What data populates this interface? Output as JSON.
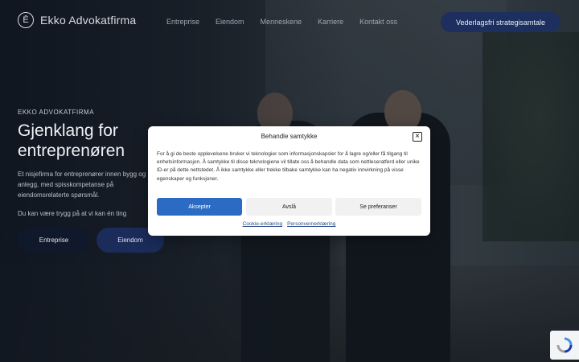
{
  "nav": {
    "brand": "Ekko Advokatfirma",
    "brand_mark": "Ē",
    "menu": [
      "Entreprise",
      "Eiendom",
      "Menneskene",
      "Karriere",
      "Kontakt oss"
    ],
    "cta": "Vederlagsfri strategisamtale"
  },
  "hero": {
    "eyebrow": "EKKO ADVOKATFIRMA",
    "headline": "Gjenklang for\nentreprenøren",
    "lede": "Et nisjefirma for entreprenører innen bygg og anlegg, med spisskompetanse på eiendomsrelaterte spørsmål.",
    "lede2": "Du kan være trygg på at vi kan én ting",
    "buttons": [
      "Entreprise",
      "Eiendom"
    ]
  },
  "consent": {
    "title": "Behandle samtykke",
    "body": "For å gi de beste opplevelsene bruker vi teknologier som informasjonskapsler for å lagre og/eller få tilgang til enhetsinformasjon. Å samtykke til disse teknologiene vil tillate oss å behandle data som nettleseratferd eller unike ID-er på dette nettstedet. Å ikke samtykke eller trekke tilbake samtykke kan ha negativ innvirkning på visse egenskaper og funksjoner.",
    "accept": "Aksepter",
    "deny": "Avslå",
    "preferences": "Se preferanser",
    "links": [
      "Cookie-erklæring",
      "Personvernerklæring"
    ],
    "close_icon": "close-icon"
  },
  "colors": {
    "accent": "#2b6bc4",
    "cta_bg": "#1c2f5e"
  }
}
